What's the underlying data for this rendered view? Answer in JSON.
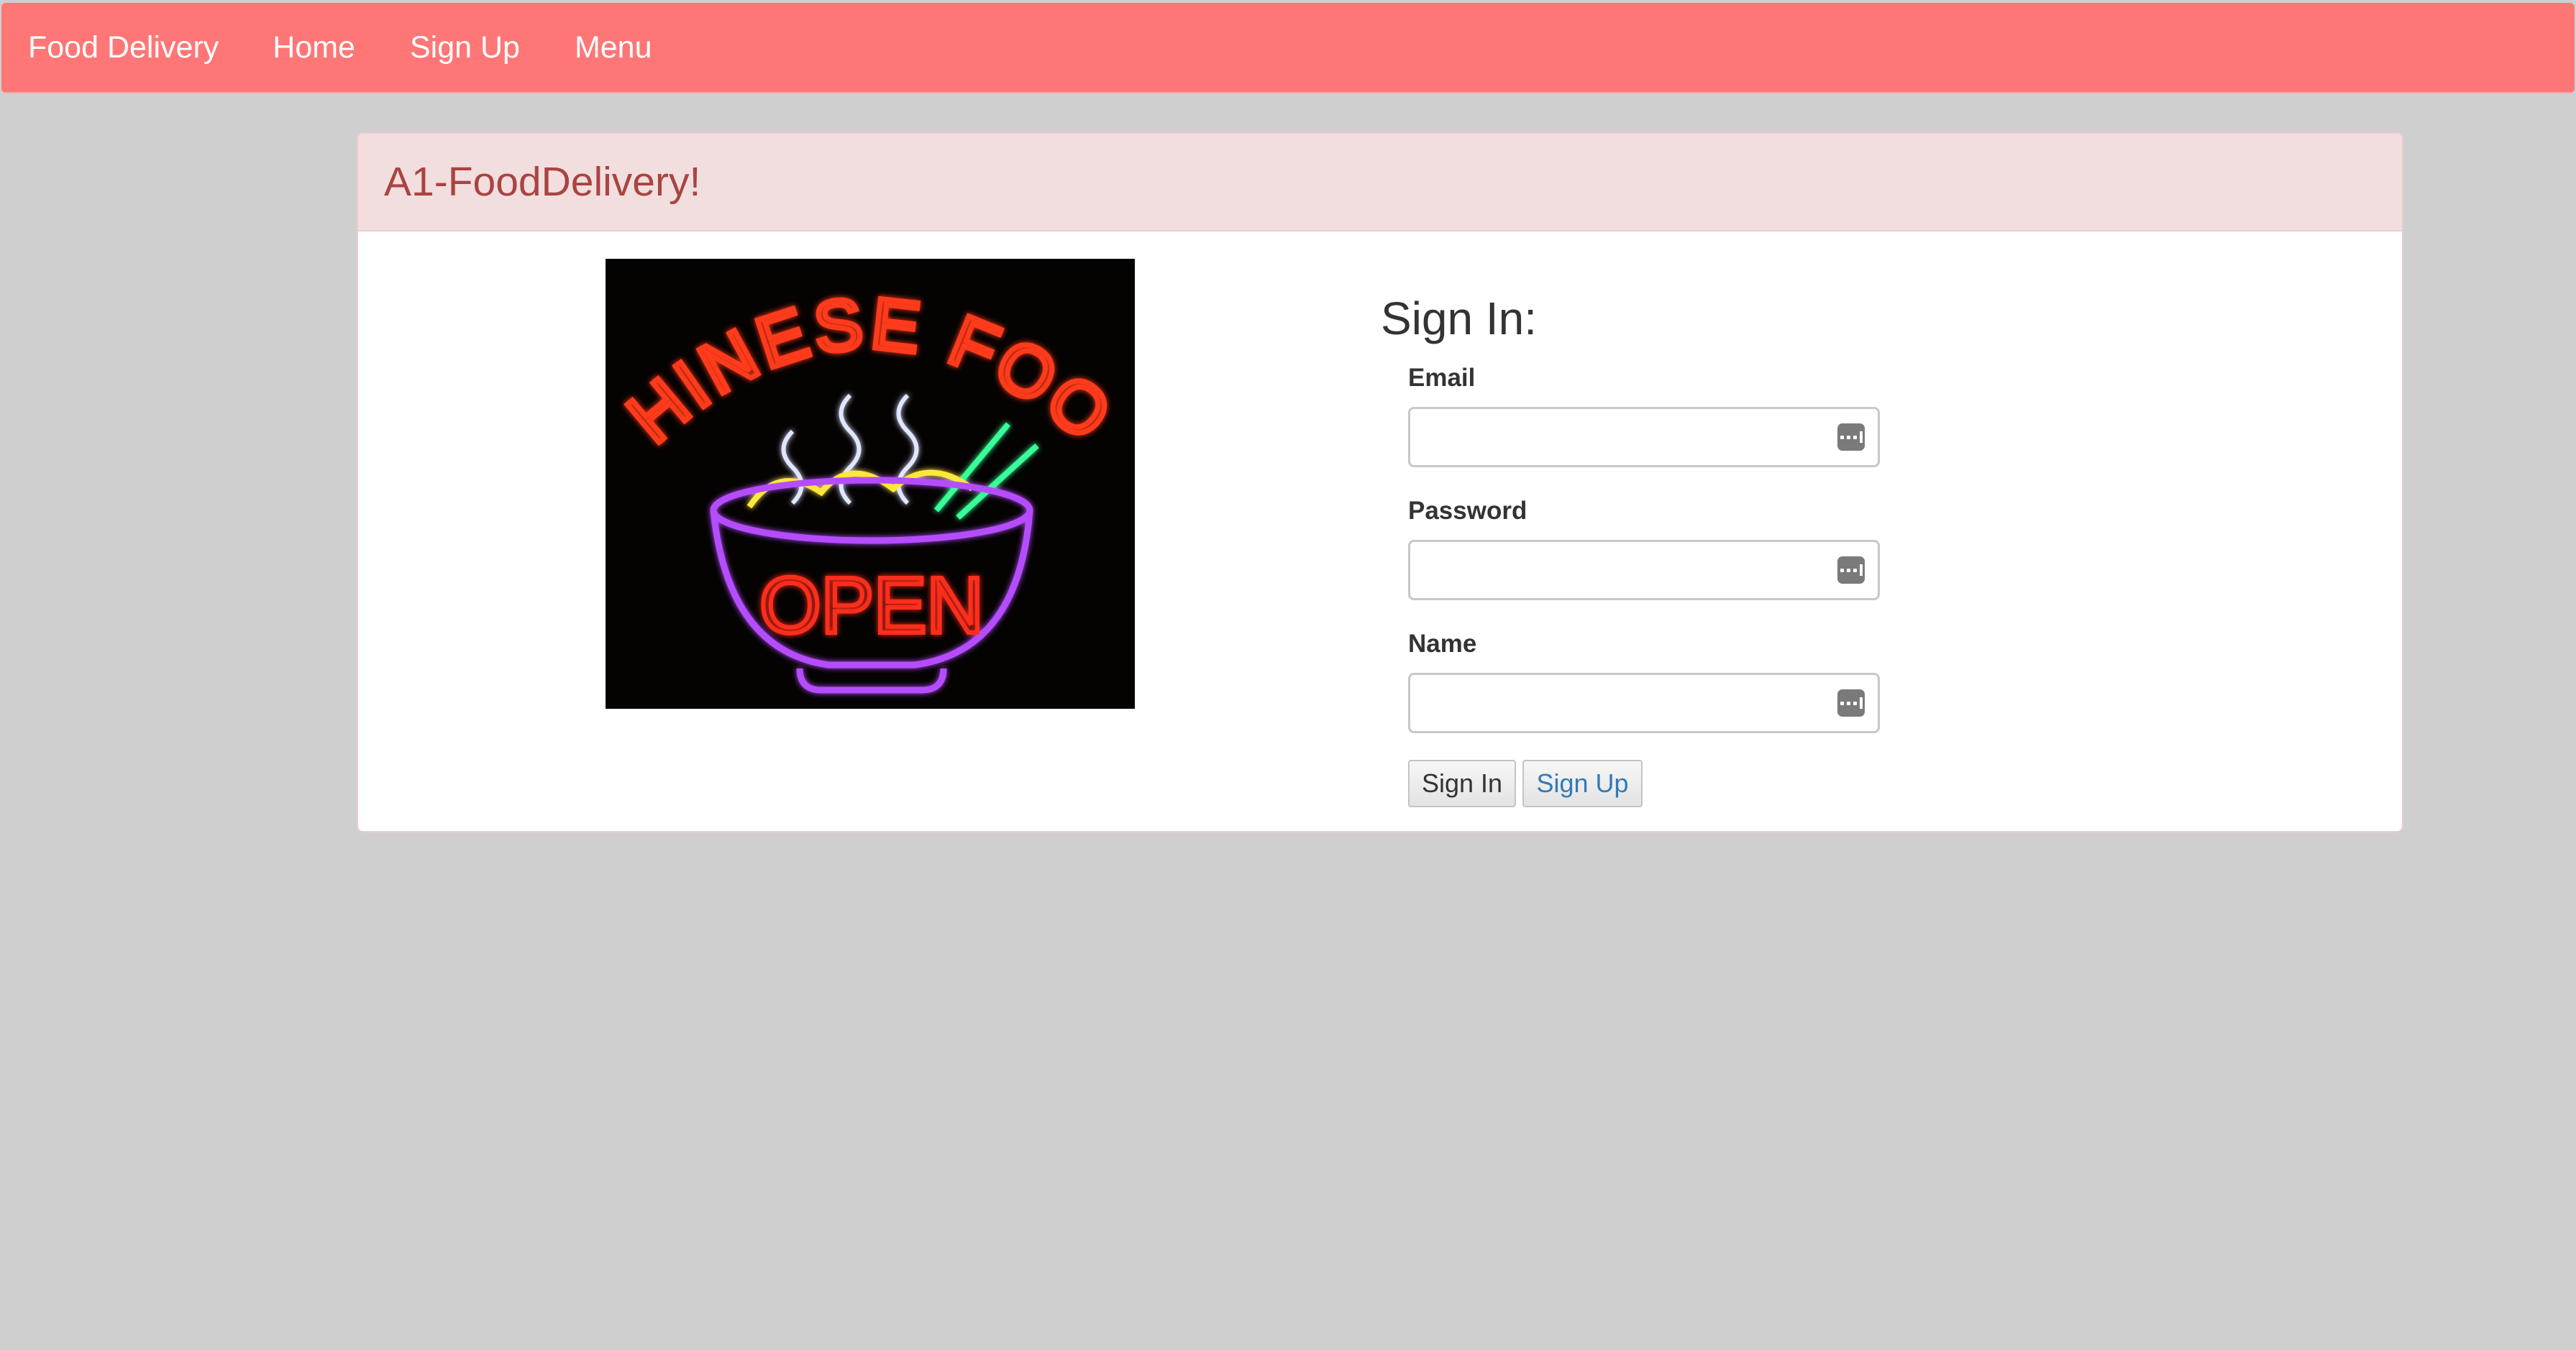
{
  "navbar": {
    "brand": "Food Delivery",
    "items": [
      {
        "label": "Home"
      },
      {
        "label": "Sign Up"
      },
      {
        "label": "Menu"
      }
    ],
    "background_color": "#ff7676"
  },
  "panel": {
    "title": "A1-FoodDelivery!",
    "heading_color": "#a94442",
    "heading_background": "#f2dede"
  },
  "image": {
    "sign_text_top": "CHINESE FOOD",
    "sign_text_bottom": "OPEN"
  },
  "form": {
    "title": "Sign In:",
    "fields": [
      {
        "label": "Email",
        "value": "",
        "icon": "password-manager-key-icon"
      },
      {
        "label": "Password",
        "value": "",
        "icon": "password-manager-key-icon"
      },
      {
        "label": "Name",
        "value": "",
        "icon": "password-manager-key-icon"
      }
    ],
    "sign_in_label": "Sign In",
    "sign_up_label": "Sign Up",
    "link_color": "#337ab7"
  }
}
